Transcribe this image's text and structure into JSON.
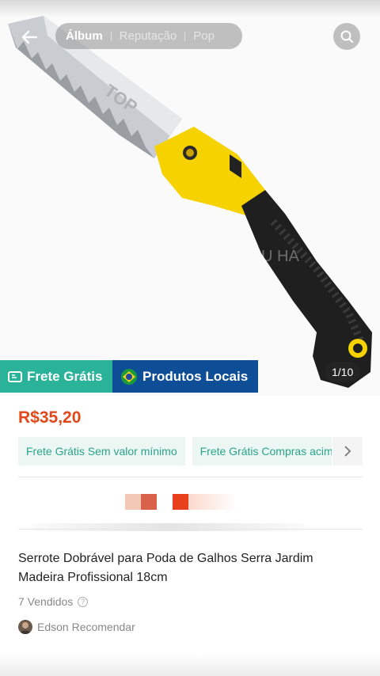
{
  "header": {
    "tabs": [
      {
        "label": "Álbum"
      },
      {
        "label": "Reputação"
      },
      {
        "label": "Pop"
      }
    ]
  },
  "gallery": {
    "counter": "1/10"
  },
  "banners": {
    "free_shipping": "Frete Grátis",
    "local_products": "Produtos Locais"
  },
  "product": {
    "price": "R$35,20",
    "title": "Serrote Dobrável para Poda de Galhos Serra Jardim Madeira Profissional 18cm",
    "sold": "7 Vendidos",
    "recommender": "Edson Recomendar"
  },
  "shipping_chips": [
    {
      "label": "Frete Grátis Sem valor mínimo"
    },
    {
      "label": "Frete Grátis Compras acima"
    }
  ],
  "colors": {
    "price": "#e0481a",
    "free_banner": "#2bb39a",
    "local_banner": "#0e4e96",
    "chip_text": "#2aa38b",
    "handle_yellow": "#f5d200"
  },
  "icons": [
    "back-arrow-icon",
    "search-icon",
    "truck-icon",
    "brazil-flag-icon",
    "chevron-right-icon",
    "help-icon"
  ]
}
